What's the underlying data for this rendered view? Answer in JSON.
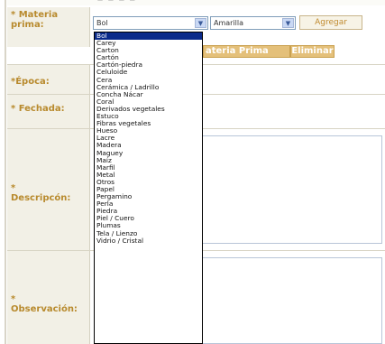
{
  "labels": {
    "materia_line1": "* Materia",
    "materia_line2": "prima:",
    "epoca": "*Época:",
    "fechada": "* Fechada:",
    "descripcion_star": "*",
    "descripcion": "Descripcón:",
    "observacion_star": "*",
    "observacion": "Observación:"
  },
  "materia_select": {
    "value": "Bol"
  },
  "color_select": {
    "value": "Amarilla"
  },
  "buttons": {
    "agregar": "Agregar",
    "materia_prima_partial": "ateria Prima",
    "eliminar": "Eliminar"
  },
  "dropdown_options": [
    "Bol",
    "Carey",
    "Carton",
    "Cartón",
    "Cartón-piedra",
    "Celuloide",
    "Cera",
    "Cerámica / Ladrillo",
    "Concha Nácar",
    "Coral",
    "Derivados vegetales",
    "Estuco",
    "Fibras vegetales",
    "Hueso",
    "Lacre",
    "Madera",
    "Maguey",
    "Maíz",
    "Marfil",
    "Metal",
    "Otros",
    "Papel",
    "Pergamino",
    "Perla",
    "Piedra",
    "Piel / Cuero",
    "Plumas",
    "Tela / Lienzo",
    "Vidrio / Cristal"
  ],
  "selected_option_index": 0,
  "colors": {
    "label_text": "#b88a2d",
    "label_bg": "#f2f0e6",
    "bar_bg": "#e4c07a",
    "selection": "#0a2a8a"
  }
}
